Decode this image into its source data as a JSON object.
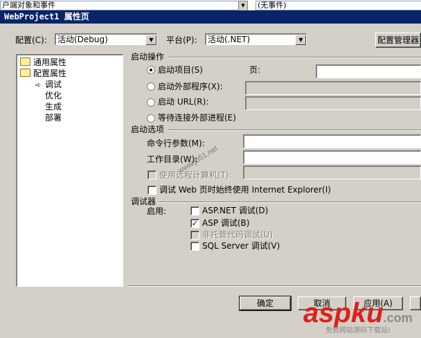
{
  "background_window": {
    "left_combo_text": "户端对象和事件",
    "right_combo_text": "(无事件)"
  },
  "dialog": {
    "title": "WebProject1 属性页"
  },
  "toolbar": {
    "config_label": "配置(C):",
    "config_value": "活动(Debug)",
    "platform_label": "平台(P):",
    "platform_value": "活动(.NET)",
    "config_manager_button": "配置管理器"
  },
  "tree": {
    "items": [
      {
        "label": "通用属性"
      },
      {
        "label": "配置属性"
      },
      {
        "label": "调试",
        "selected": true
      },
      {
        "label": "优化"
      },
      {
        "label": "生成"
      },
      {
        "label": "部署"
      }
    ]
  },
  "startup_action": {
    "header": "启动操作",
    "start_project": "启动项目(S)",
    "page_label": "页:",
    "start_external": "启动外部程序(X):",
    "start_url": "启动 URL(R):",
    "wait_external": "等待连接外部进程(E)"
  },
  "startup_options": {
    "header": "启动选项",
    "command_args": "命令行参数(M):",
    "working_dir": "工作目录(W):",
    "use_remote": "使用远程计算机(T):",
    "always_ie": "调试 Web 页时始终使用 Internet Explorer(I)"
  },
  "debuggers": {
    "header": "调试器",
    "enable_label": "启用:",
    "aspnet_debug": {
      "label": "ASP.NET 调试(D)",
      "checked": false
    },
    "asp_debug": {
      "label": "ASP 调试(B)",
      "checked": true
    },
    "unmanaged_debug": {
      "label": "非托管代码调试(U)",
      "checked": false
    },
    "sql_debug": {
      "label": "SQL Server 调试(V)",
      "checked": false
    }
  },
  "buttons": {
    "ok": "确定",
    "cancel": "取消",
    "apply": "应用(A)"
  },
  "watermarks": {
    "diagonal": "www.jb51.net",
    "brand": "aspku",
    "brand_com": ".com",
    "brand_sub": "免费网站源码下载站!"
  },
  "colors": {
    "dialog_bg": "#d4d0c8",
    "titlebar": "#0a246a",
    "brand_red": "#e0201a",
    "brand_gray": "#8a8a8a"
  }
}
